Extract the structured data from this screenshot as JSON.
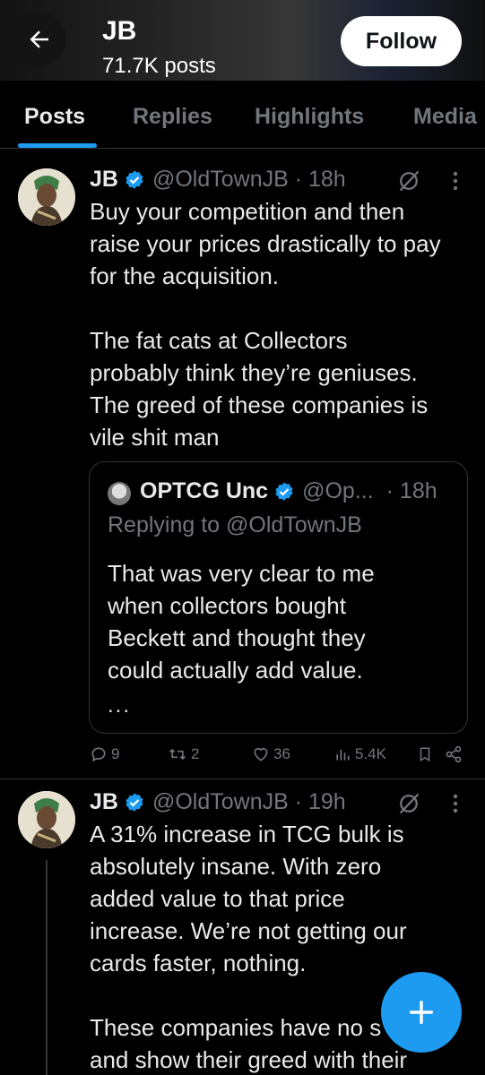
{
  "header": {
    "name": "JB",
    "posts_count": "71.7K posts",
    "follow_label": "Follow"
  },
  "tabs": [
    {
      "label": "Posts",
      "active": true
    },
    {
      "label": "Replies",
      "active": false
    },
    {
      "label": "Highlights",
      "active": false
    },
    {
      "label": "Media",
      "active": false
    }
  ],
  "tweets": [
    {
      "name": "JB",
      "handle_time": "@OldTownJB · 18h",
      "body": "Buy your competition and then\nraise your prices drastically to pay\nfor the acquisition.\n\nThe fat cats at Collectors\nprobably think they’re geniuses.\nThe greed of these companies is\nvile shit man",
      "quote": {
        "name": "OPTCG Unc",
        "handle": "@Op...",
        "time": "· 18h",
        "replying_to": "Replying to @OldTownJB",
        "body": "That was very clear to me\nwhen collectors bought\nBeckett and thought they\ncould actually add value.",
        "more": "..."
      },
      "stats": {
        "replies": "9",
        "reposts": "2",
        "likes": "36",
        "views": "5.4K"
      }
    },
    {
      "name": "JB",
      "handle_time": "@OldTownJB · 19h",
      "body": "A 31% increase in TCG bulk is\nabsolutely insane. With zero\nadded value to that price\nincrease. We’re not getting our\ncards faster, nothing.\n\nThese companies have no s\nand show their greed with their"
    }
  ],
  "colors": {
    "accent": "#1d9bf0",
    "muted": "#71767b",
    "text": "#e7e9ea",
    "border": "#2f3336"
  }
}
